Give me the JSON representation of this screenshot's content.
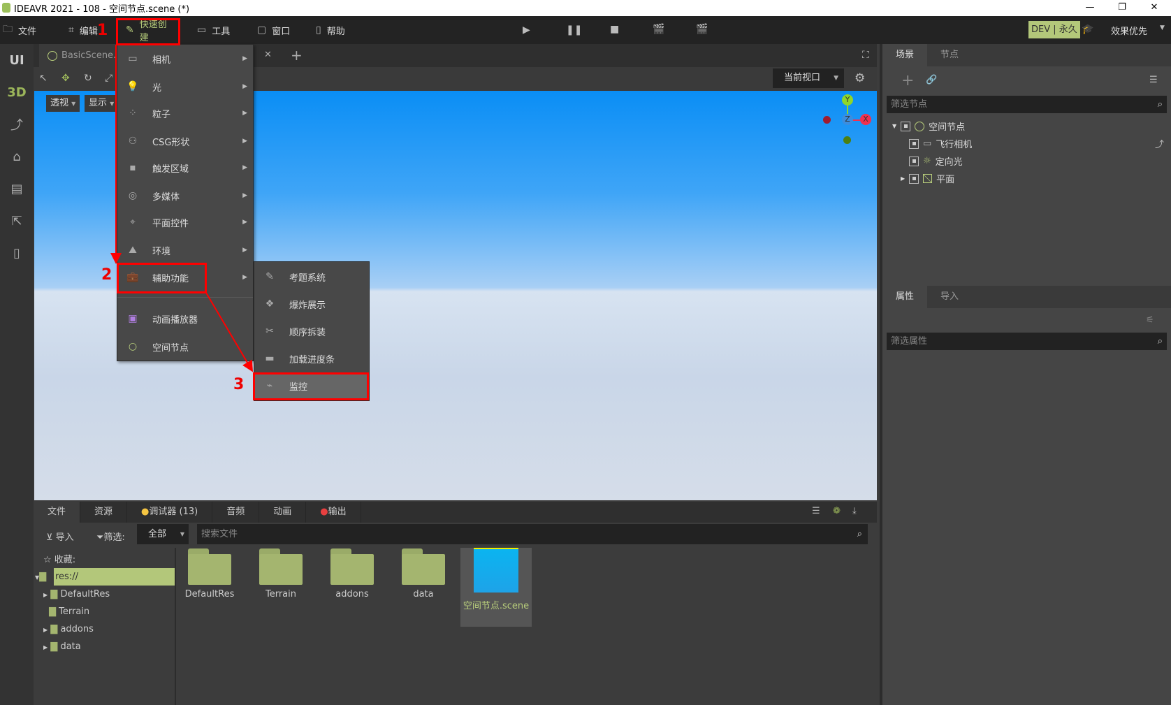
{
  "window": {
    "title": "IDEAVR 2021 - 108 - 空间节点.scene (*)",
    "minimize": "—",
    "restore": "❐",
    "close": "✕"
  },
  "menubar": {
    "items": [
      {
        "label": "文件",
        "icon": "folder-icon"
      },
      {
        "label": "编辑",
        "icon": "crop-icon"
      },
      {
        "label": "快速创建",
        "icon": "edit-icon"
      },
      {
        "label": "工具",
        "icon": "window-icon"
      },
      {
        "label": "窗口",
        "icon": "frame-icon"
      },
      {
        "label": "帮助",
        "icon": "book-icon"
      }
    ],
    "license": "DEV | 永久",
    "quality": "效果优先"
  },
  "leftstrip": {
    "ui": "UI",
    "threed": "3D"
  },
  "scene_tabs": {
    "tab": "BasicScene.s",
    "add": "+",
    "close": "✕"
  },
  "viewport": {
    "perspective": "透视",
    "display": "显示",
    "camera_select": "当前视口",
    "axis": {
      "y": "Y",
      "x": "X",
      "z": "Z"
    }
  },
  "quick_create_menu": {
    "items": [
      {
        "label": "相机",
        "icon": "camera-icon",
        "submenu": true
      },
      {
        "label": "光",
        "icon": "bulb-icon",
        "submenu": true
      },
      {
        "label": "粒子",
        "icon": "particles-icon",
        "submenu": true
      },
      {
        "label": "CSG形状",
        "icon": "csg-icon",
        "submenu": true
      },
      {
        "label": "触发区域",
        "icon": "trigger-icon",
        "submenu": true
      },
      {
        "label": "多媒体",
        "icon": "media-icon",
        "submenu": true
      },
      {
        "label": "平面控件",
        "icon": "plane-control-icon",
        "submenu": true
      },
      {
        "label": "环境",
        "icon": "environment-icon",
        "submenu": true
      },
      {
        "label": "辅助功能",
        "icon": "toolbox-icon",
        "submenu": true
      },
      {
        "label": "动画播放器",
        "icon": "animation-icon",
        "submenu": false
      },
      {
        "label": "空间节点",
        "icon": "circle-icon",
        "submenu": false
      }
    ]
  },
  "aux_submenu": {
    "items": [
      {
        "label": "考题系统",
        "icon": "exam-icon"
      },
      {
        "label": "爆炸展示",
        "icon": "explode-icon"
      },
      {
        "label": "顺序拆装",
        "icon": "tools-icon"
      },
      {
        "label": "加载进度条",
        "icon": "progress-icon"
      },
      {
        "label": "监控",
        "icon": "cctv-icon"
      }
    ]
  },
  "annotations": {
    "step1": "1",
    "step2": "2",
    "step3": "3",
    "color": "#ff0000"
  },
  "scene_panel": {
    "tabs": [
      "场景",
      "节点"
    ],
    "filter_placeholder": "筛选节点",
    "tree": [
      {
        "label": "空间节点"
      },
      {
        "label": "飞行相机"
      },
      {
        "label": "定向光"
      },
      {
        "label": "平面"
      }
    ]
  },
  "props_panel": {
    "tabs": [
      "属性",
      "导入"
    ],
    "filter_placeholder": "筛选属性"
  },
  "bottom": {
    "tabs": [
      "文件",
      "资源",
      "调试器 (13)",
      "音频",
      "动画",
      "输出"
    ],
    "import": "导入",
    "filter_label": "筛选:",
    "filter_value": "全部",
    "search_placeholder": "搜索文件",
    "favorites": "收藏:",
    "tree": [
      "res://",
      "DefaultRes",
      "Terrain",
      "addons",
      "data"
    ],
    "files": [
      "DefaultRes",
      "Terrain",
      "addons",
      "data",
      "空间节点.scene"
    ]
  },
  "colors": {
    "accent": "#b9cf7c",
    "sky": "#0a8ef5"
  }
}
